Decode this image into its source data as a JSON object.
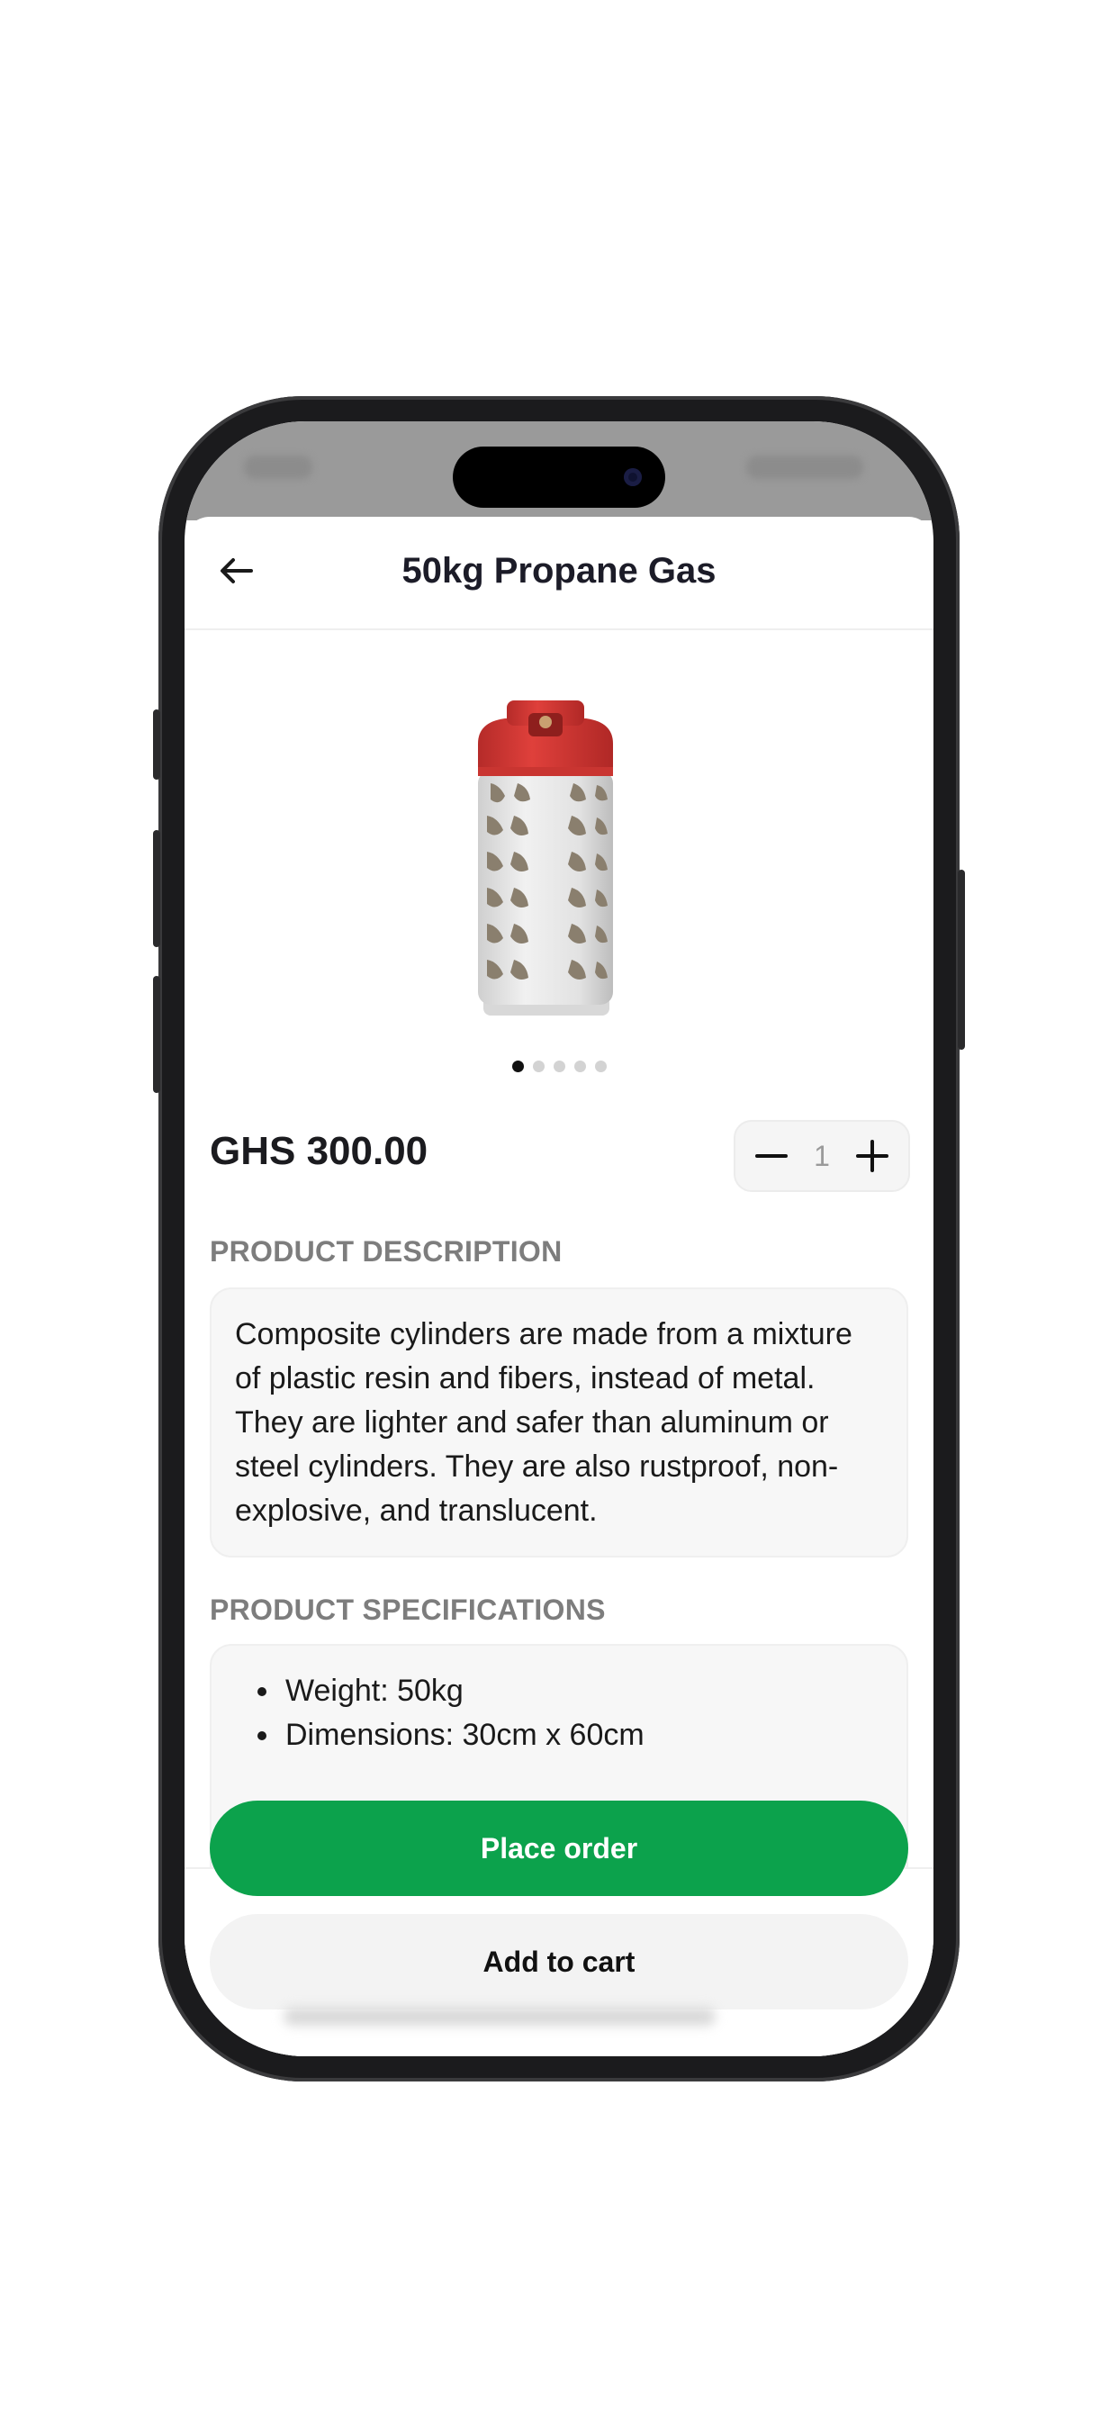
{
  "header": {
    "title": "50kg Propane Gas",
    "back_icon": "arrow-left-icon"
  },
  "product": {
    "image": "propane-cylinder",
    "carousel": {
      "count": 5,
      "active_index": 0
    },
    "price": "GHS 300.00",
    "quantity": "1"
  },
  "description": {
    "label": "PRODUCT DESCRIPTION",
    "text": "Composite cylinders are made from a mixture of plastic resin and fibers, instead of metal. They are lighter and safer than aluminum or steel cylinders. They are also rustproof, non-explosive, and translucent."
  },
  "specifications": {
    "label": "PRODUCT SPECIFICATIONS",
    "items": [
      "Weight: 50kg",
      "Dimensions: 30cm x 60cm"
    ]
  },
  "actions": {
    "place_order": "Place order",
    "add_to_cart": "Add to cart"
  },
  "colors": {
    "primary": "#0ca24c",
    "cylinder_top": "#d93a36",
    "text": "#1c1c28"
  }
}
